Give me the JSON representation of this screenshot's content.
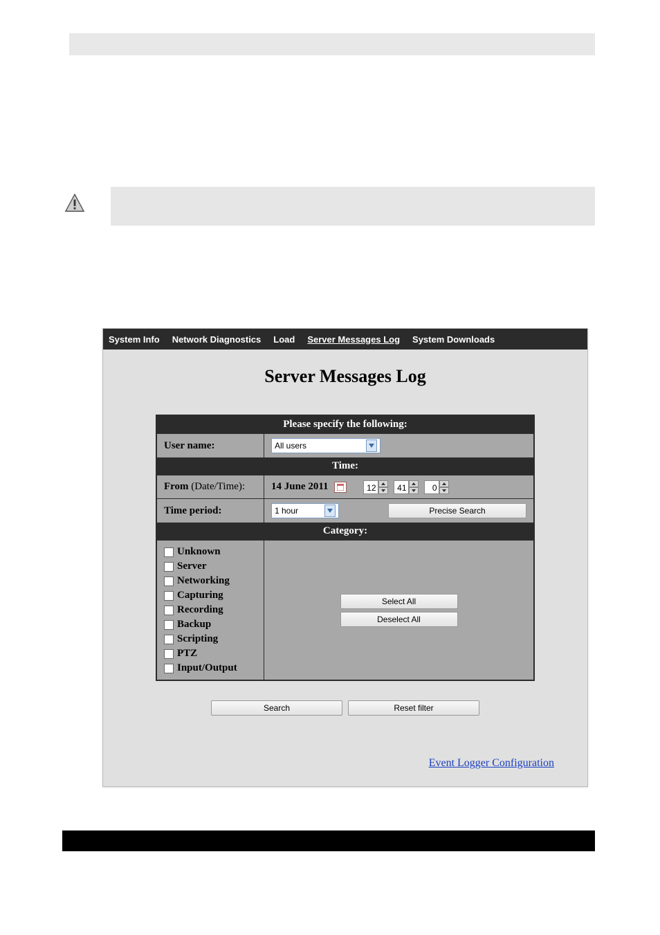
{
  "header_text": "",
  "note_text": "",
  "tabs": {
    "system_info": "System Info",
    "network_diag": "Network Diagnostics",
    "load": "Load",
    "server_msg": "Server Messages Log",
    "downloads": "System Downloads"
  },
  "title": "Server Messages Log",
  "section": {
    "specify": "Please specify the following:",
    "time": "Time:",
    "category": "Category:"
  },
  "labels": {
    "username": "User name:",
    "from_bold": "From ",
    "from_sub": "(Date/Time):",
    "period": "Time period:"
  },
  "values": {
    "user_sel": "All users",
    "date": "14 June 2011",
    "hh": "12",
    "mm": "41",
    "ss": "0",
    "period_sel": "1 hour"
  },
  "buttons": {
    "precise": "Precise Search",
    "select_all": "Select All",
    "deselect_all": "Deselect All",
    "search": "Search",
    "reset": "Reset filter"
  },
  "categories": [
    "Unknown",
    "Server",
    "Networking",
    "Capturing",
    "Recording",
    "Backup",
    "Scripting",
    "PTZ",
    "Input/Output"
  ],
  "link": "Event Logger Configuration"
}
